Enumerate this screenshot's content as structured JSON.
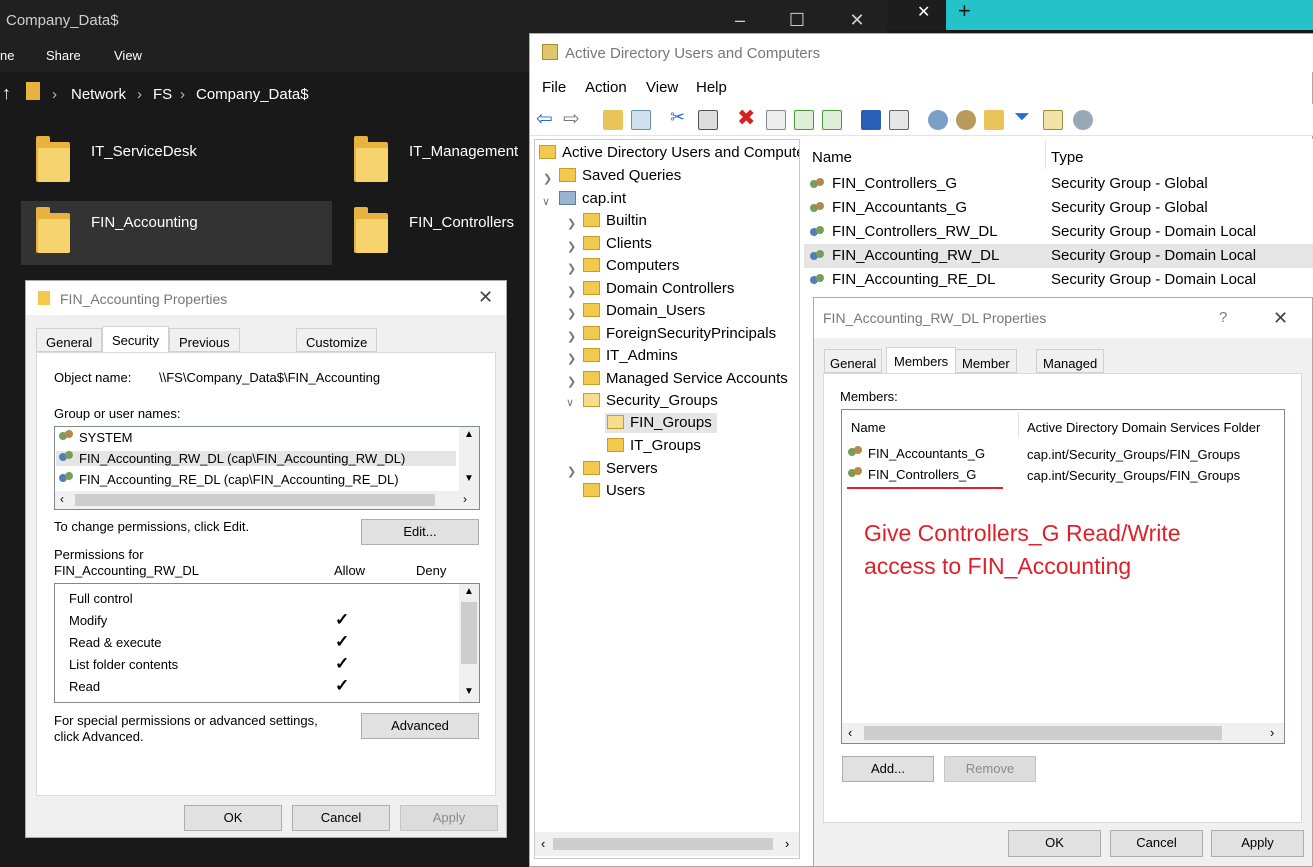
{
  "explorer": {
    "title": "Company_Data$",
    "ribbon": [
      "ne",
      "Share",
      "View"
    ],
    "breadcrumb": [
      "Network",
      "FS",
      "Company_Data$"
    ],
    "folders": [
      {
        "name": "IT_ServiceDesk"
      },
      {
        "name": "IT_Management"
      },
      {
        "name": "FIN_Accounting"
      },
      {
        "name": "FIN_Controllers"
      }
    ]
  },
  "folder_props": {
    "title": "FIN_Accounting Properties",
    "tabs": [
      "General",
      "Security",
      "Previous Versions",
      "Customize"
    ],
    "object_label": "Object name:",
    "object_value": "\\\\FS\\Company_Data$\\FIN_Accounting",
    "groups_label": "Group or user names:",
    "groups": [
      "SYSTEM",
      "FIN_Accounting_RW_DL (cap\\FIN_Accounting_RW_DL)",
      "FIN_Accounting_RE_DL (cap\\FIN_Accounting_RE_DL)"
    ],
    "change_text": "To change permissions, click Edit.",
    "edit_btn": "Edit...",
    "perm_for_1": "Permissions for",
    "perm_for_2": "FIN_Accounting_RW_DL",
    "allow": "Allow",
    "deny": "Deny",
    "permissions": [
      {
        "name": "Full control",
        "allow": false
      },
      {
        "name": "Modify",
        "allow": true
      },
      {
        "name": "Read & execute",
        "allow": true
      },
      {
        "name": "List folder contents",
        "allow": true
      },
      {
        "name": "Read",
        "allow": true
      }
    ],
    "special_1": "For special permissions or advanced settings,",
    "special_2": "click Advanced.",
    "advanced_btn": "Advanced",
    "ok": "OK",
    "cancel": "Cancel",
    "apply": "Apply"
  },
  "aduc": {
    "title": "Active Directory Users and Computers",
    "menu": [
      "File",
      "Action",
      "View",
      "Help"
    ],
    "tree": {
      "root": "Active Directory Users and Compute",
      "saved": "Saved Queries",
      "domain": "cap.int",
      "ous": [
        "Builtin",
        "Clients",
        "Computers",
        "Domain Controllers",
        "Domain_Users",
        "ForeignSecurityPrincipals",
        "IT_Admins",
        "Managed Service Accounts",
        "Security_Groups"
      ],
      "sub": [
        "FIN_Groups",
        "IT_Groups"
      ],
      "after": [
        "Servers",
        "Users"
      ]
    },
    "columns": [
      "Name",
      "Type"
    ],
    "rows": [
      {
        "name": "FIN_Controllers_G",
        "type": "Security Group - Global"
      },
      {
        "name": "FIN_Accountants_G",
        "type": "Security Group - Global"
      },
      {
        "name": "FIN_Controllers_RW_DL",
        "type": "Security Group - Domain Local"
      },
      {
        "name": "FIN_Accounting_RW_DL",
        "type": "Security Group - Domain Local"
      },
      {
        "name": "FIN_Accounting_RE_DL",
        "type": "Security Group - Domain Local"
      }
    ]
  },
  "group_props": {
    "title": "FIN_Accounting_RW_DL Properties",
    "help": "?",
    "tabs": [
      "General",
      "Members",
      "Member Of",
      "Managed By"
    ],
    "members_label": "Members:",
    "col_name": "Name",
    "col_folder": "Active Directory Domain Services Folder",
    "members": [
      {
        "name": "FIN_Accountants_G",
        "folder": "cap.int/Security_Groups/FIN_Groups"
      },
      {
        "name": "FIN_Controllers_G",
        "folder": "cap.int/Security_Groups/FIN_Groups"
      }
    ],
    "annotation_1": "Give Controllers_G Read/Write",
    "annotation_2": "access to FIN_Accounting",
    "add_btn": "Add...",
    "remove_btn": "Remove",
    "ok": "OK",
    "cancel": "Cancel",
    "apply": "Apply"
  },
  "colors": {
    "annotation": "#e0202a",
    "taskbar": "#25c3c9",
    "folder": "#f6d36c"
  }
}
